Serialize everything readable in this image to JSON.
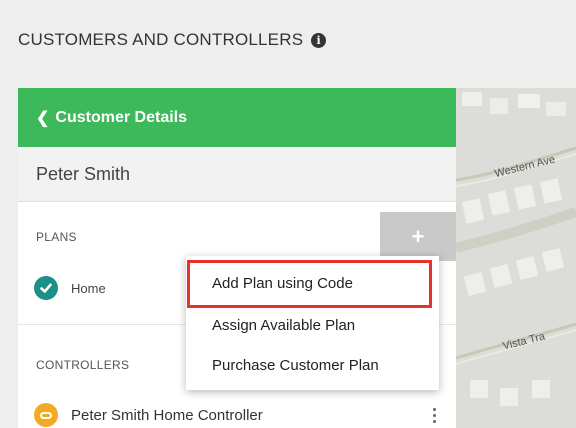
{
  "page": {
    "title": "CUSTOMERS AND CONTROLLERS",
    "info_icon": "info-icon"
  },
  "panel": {
    "back_label": "Customer Details",
    "customer_name": "Peter Smith",
    "plans_label": "PLANS",
    "add_button_label": "+",
    "plans": [
      {
        "label": "Home",
        "icon": "check-circle-icon"
      }
    ],
    "controllers_label": "CONTROLLERS",
    "controllers": [
      {
        "label": "Peter Smith Home Controller",
        "icon": "controller-icon"
      }
    ]
  },
  "menu": {
    "items": [
      {
        "label": "Add Plan using Code",
        "highlighted": true
      },
      {
        "label": "Assign Available Plan"
      },
      {
        "label": "Purchase Customer Plan"
      }
    ]
  },
  "map": {
    "street_1": "Western Ave",
    "street_2": "Vista Tra"
  },
  "colors": {
    "header_green": "#3db85a",
    "plan_teal": "#1c8f88",
    "controller_orange": "#f3a924",
    "highlight_red": "#e5332a"
  }
}
